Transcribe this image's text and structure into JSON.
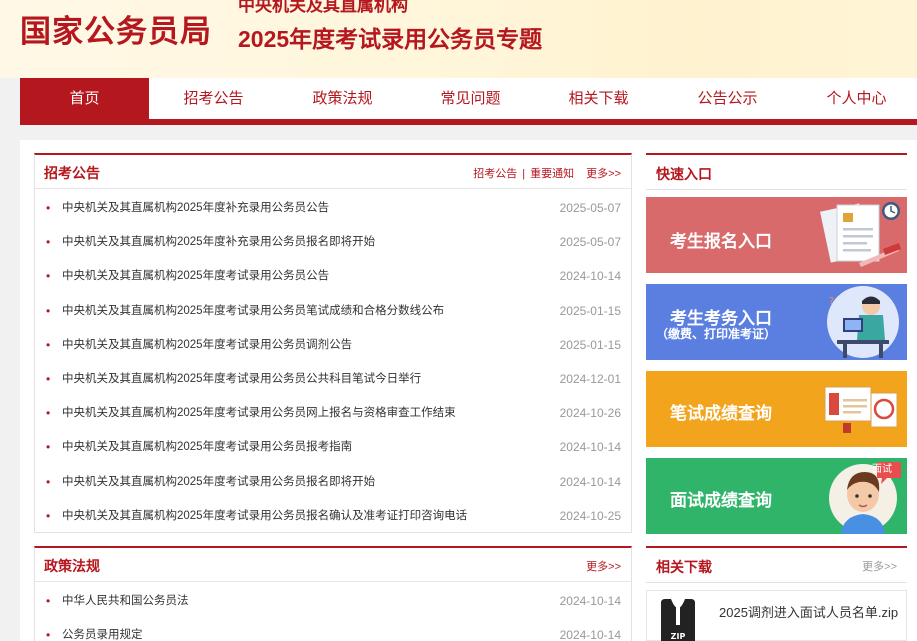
{
  "header": {
    "logo": "国家公务员局",
    "subtitle": "中央机关及其直属机构",
    "title": "2025年度考试录用公务员专题"
  },
  "nav": {
    "items": [
      "首页",
      "招考公告",
      "政策法规",
      "常见问题",
      "相关下载",
      "公告公示",
      "个人中心"
    ],
    "active": "首页"
  },
  "announcements": {
    "title": "招考公告",
    "links": [
      "招考公告",
      "重要通知"
    ],
    "more": "更多>>",
    "items": [
      {
        "text": "中央机关及其直属机构2025年度补充录用公务员公告",
        "date": "2025-05-07"
      },
      {
        "text": "中央机关及其直属机构2025年度补充录用公务员报名即将开始",
        "date": "2025-05-07"
      },
      {
        "text": "中央机关及其直属机构2025年度考试录用公务员公告",
        "date": "2024-10-14"
      },
      {
        "text": "中央机关及其直属机构2025年度考试录用公务员笔试成绩和合格分数线公布",
        "date": "2025-01-15"
      },
      {
        "text": "中央机关及其直属机构2025年度考试录用公务员调剂公告",
        "date": "2025-01-15"
      },
      {
        "text": "中央机关及其直属机构2025年度考试录用公务员公共科目笔试今日举行",
        "date": "2024-12-01"
      },
      {
        "text": "中央机关及其直属机构2025年度考试录用公务员网上报名与资格审查工作结束",
        "date": "2024-10-26"
      },
      {
        "text": "中央机关及其直属机构2025年度考试录用公务员报考指南",
        "date": "2024-10-14"
      },
      {
        "text": "中央机关及其直属机构2025年度考试录用公务员报名即将开始",
        "date": "2024-10-14"
      },
      {
        "text": "中央机关及其直属机构2025年度考试录用公务员报名确认及准考证打印咨询电话",
        "date": "2024-10-25"
      }
    ]
  },
  "quick_entry": {
    "title": "快速入口",
    "items": [
      {
        "label": "考生报名入口",
        "color": "#d86a6c"
      },
      {
        "label": "考生考务入口",
        "sub": "（缴费、打印准考证）",
        "color": "#5a7fe0"
      },
      {
        "label": "笔试成绩查询",
        "color": "#f2a51c"
      },
      {
        "label": "面试成绩查询",
        "color": "#2fb469",
        "badge": "面试"
      }
    ]
  },
  "policy": {
    "title": "政策法规",
    "more": "更多>>",
    "items": [
      {
        "text": "中华人民共和国公务员法",
        "date": "2024-10-14"
      },
      {
        "text": "公务员录用规定",
        "date": "2024-10-14"
      }
    ]
  },
  "downloads": {
    "title": "相关下载",
    "more": "更多>>",
    "file": "2025调剂进入面试人员名单.zip",
    "file_icon_text": "ZIP"
  },
  "colors": {
    "brand": "#b5171e",
    "date": "#999999"
  }
}
